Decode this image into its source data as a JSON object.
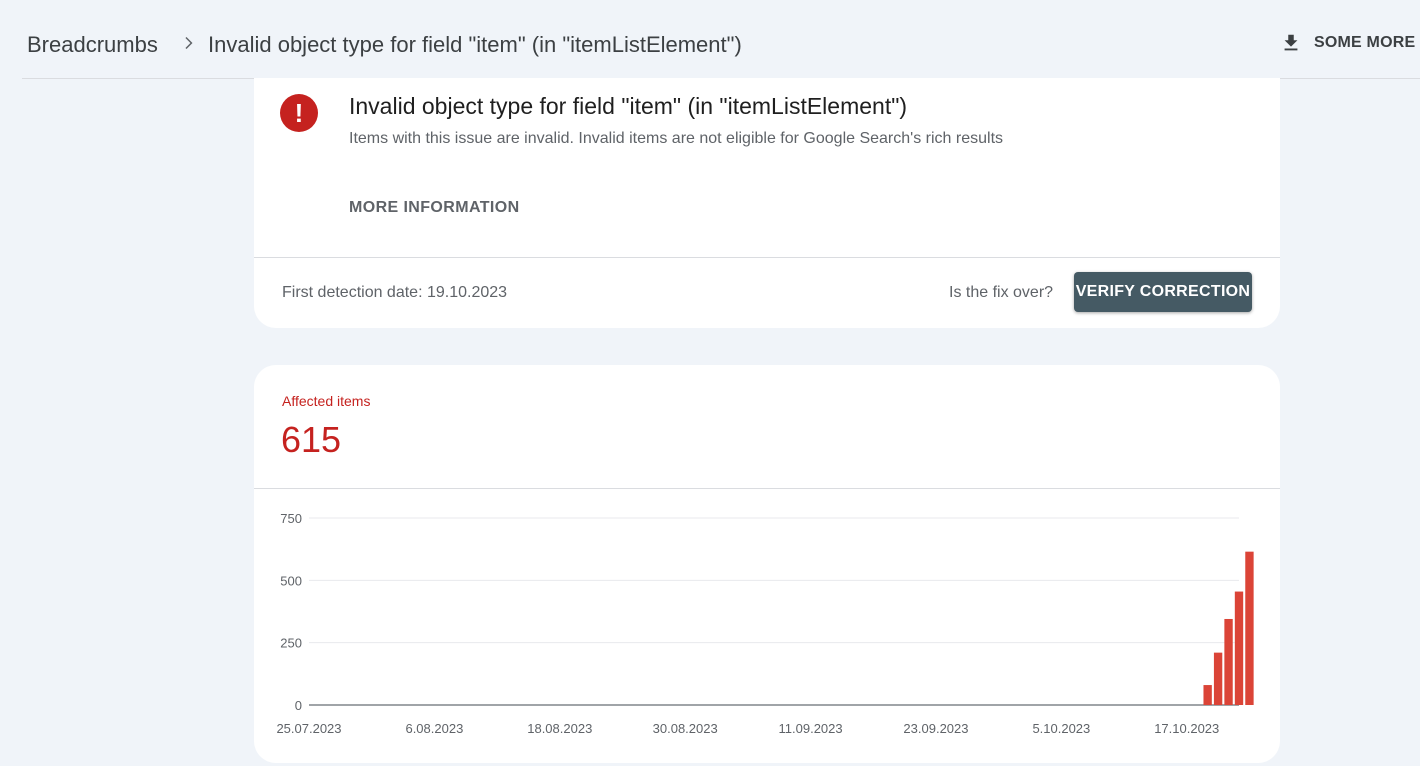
{
  "header": {
    "breadcrumb_root": "Breadcrumbs",
    "breadcrumb_current": "Invalid object type for field \"item\" (in \"itemListElement\")",
    "export_label": "SOME MORE"
  },
  "issue": {
    "title": "Invalid object type for field \"item\" (in \"itemListElement\")",
    "description": "Items with this issue are invalid. Invalid items are not eligible for Google Search's rich results",
    "more_info_label": "MORE INFORMATION",
    "first_detection": "First detection date: 19.10.2023",
    "fix_question": "Is the fix over?",
    "verify_label": "VERIFY CORRECTION"
  },
  "affected": {
    "label": "Affected items",
    "count": "615"
  },
  "colors": {
    "error": "#c5221f",
    "bar": "#db4437",
    "button": "#455a64",
    "background": "#f0f4f9"
  },
  "chart_data": {
    "type": "bar",
    "title": "",
    "xlabel": "",
    "ylabel": "",
    "ylim": [
      0,
      750
    ],
    "yticks": [
      0,
      250,
      500,
      750
    ],
    "x_start": "25.07.2023",
    "x_end": "22.10.2023",
    "xtick_labels": [
      "25.07.2023",
      "6.08.2023",
      "18.08.2023",
      "30.08.2023",
      "11.09.2023",
      "23.09.2023",
      "5.10.2023",
      "17.10.2023"
    ],
    "categories": [
      "19.10.2023",
      "20.10.2023",
      "21.10.2023",
      "22.10.2023",
      "23.10.2023"
    ],
    "values": [
      80,
      210,
      345,
      455,
      615
    ],
    "grid": true
  }
}
